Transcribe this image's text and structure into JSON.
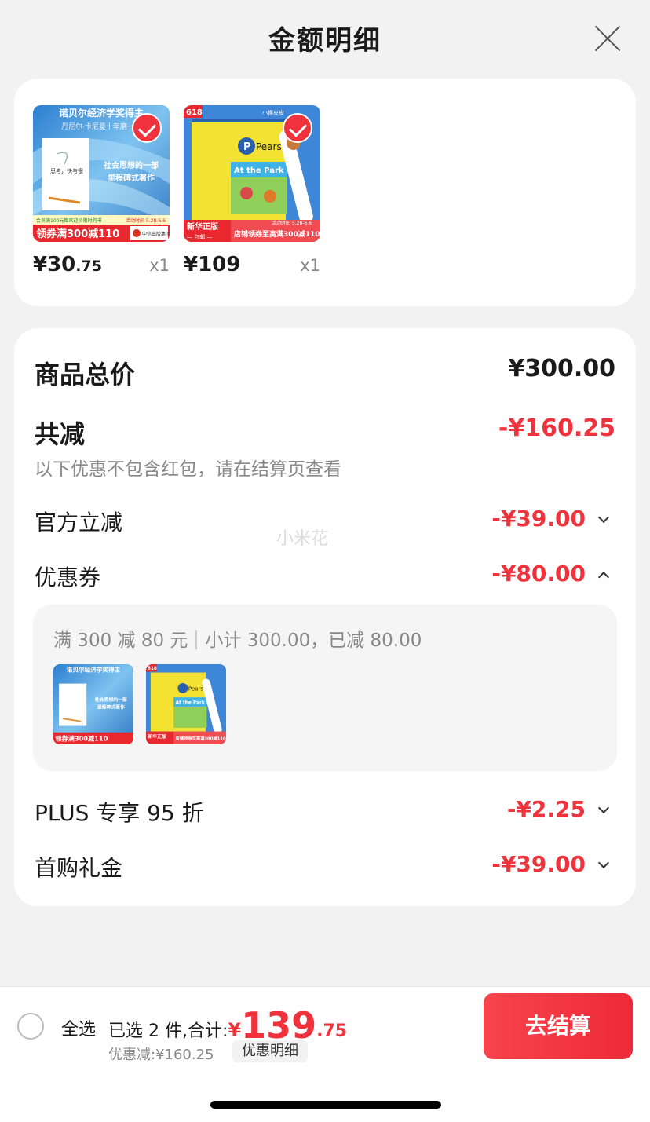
{
  "header": {
    "title": "金额明细"
  },
  "products": [
    {
      "title_top": "诺贝尔经济学奖得主",
      "subtitle": "丹尼尔·卡尼曼十年磨一剑",
      "slogan_line1": "社会思想的一部",
      "slogan_line2": "里程碑式著作",
      "book_name": "思考，快与慢",
      "banner_note": "会员满100元赠欢迎价限时购书",
      "date_note": "活动时间 5.28-6.6",
      "coupon_banner": "领券满300减110",
      "publisher": "中信出版集团",
      "price_main": "¥30",
      "price_cents": ".75",
      "qty": "x1",
      "selected": true
    },
    {
      "badge": "618",
      "brand": "Pearson",
      "book_title": "At the Park",
      "top_label": "小猴皮皮",
      "left_banner": "新华正版",
      "left_sub": "— 包邮 —",
      "right_banner": "店铺领券至高满300减110",
      "date_note": "活动时间 5.28-6.6",
      "price_main": "¥109",
      "price_cents": "",
      "qty": "x1",
      "selected": true
    }
  ],
  "details": {
    "total_label": "商品总价",
    "total_value": "¥300.00",
    "reduce_label": "共减",
    "reduce_value": "-¥160.25",
    "note": "以下优惠不包含红包，请在结算页查看",
    "watermark": "小米花",
    "official_label": "官方立减",
    "official_value": "-¥39.00",
    "coupon_label": "优惠券",
    "coupon_value": "-¥80.00",
    "coupon_rule": "满 300 减 80 元",
    "coupon_subtotal": "小计 300.00，已减 80.00",
    "plus_label": "PLUS 专享 95 折",
    "plus_value": "-¥2.25",
    "gift_label": "首购礼金",
    "gift_value": "-¥39.00"
  },
  "bottom": {
    "select_all": "全选",
    "summary_prefix": "已选 2 件,合计:",
    "currency": "¥",
    "amount_main": "139",
    "amount_cents": ".75",
    "discount_text": "优惠减:¥160.25",
    "detail_chip": "优惠明细",
    "checkout": "去结算"
  },
  "colors": {
    "accent": "#f0323c",
    "background": "#f2f2f2"
  }
}
